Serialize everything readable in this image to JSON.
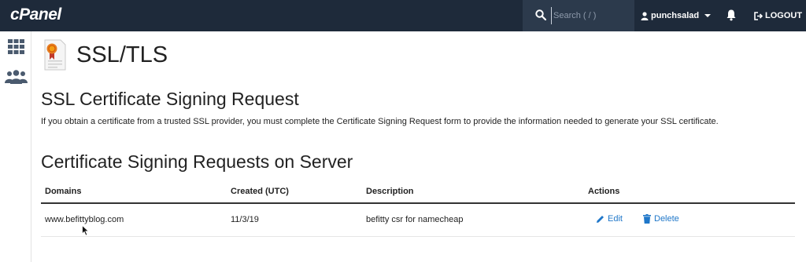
{
  "header": {
    "logo": "cPanel",
    "search_placeholder": "Search ( / )",
    "username": "punchsalad",
    "logout_label": "LOGOUT"
  },
  "page": {
    "title": "SSL/TLS"
  },
  "csr": {
    "heading": "SSL Certificate Signing Request",
    "description": "If you obtain a certificate from a trusted SSL provider, you must complete the Certificate Signing Request form to provide the information needed to generate your SSL certificate."
  },
  "requests": {
    "heading": "Certificate Signing Requests on Server",
    "columns": {
      "domains": "Domains",
      "created": "Created (UTC)",
      "description": "Description",
      "actions": "Actions"
    },
    "rows": [
      {
        "domain": "www.befittyblog.com",
        "created": "11/3/19",
        "description": "befitty csr for namecheap",
        "edit_label": "Edit",
        "delete_label": "Delete"
      }
    ]
  },
  "colors": {
    "topbar": "#1e2a3a",
    "link": "#1f77c9"
  }
}
